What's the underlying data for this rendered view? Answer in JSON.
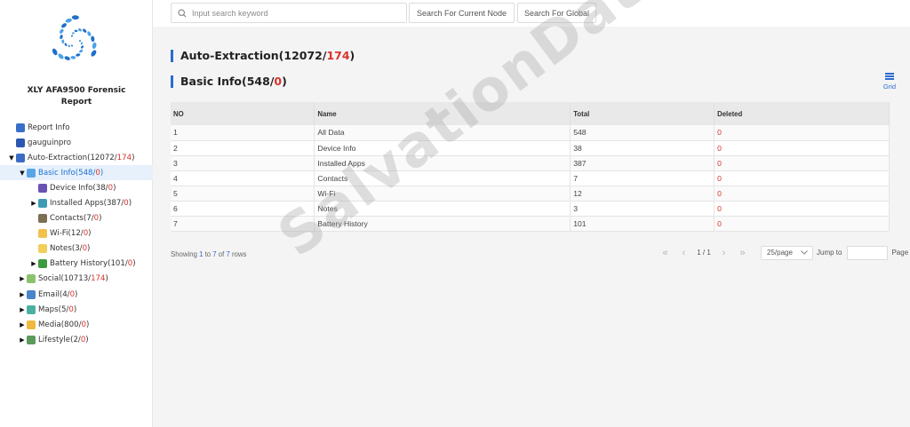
{
  "sidebar": {
    "report_title_line1": "XLY AFA9500 Forensic",
    "report_title_line2": "Report",
    "tree": [
      {
        "label": "Report Info",
        "count": "",
        "red": "",
        "close": "",
        "level": 0,
        "caret": "",
        "icon": "report-icon",
        "color": "#3a6fc9"
      },
      {
        "label": "gauguinpro",
        "count": "",
        "red": "",
        "close": "",
        "level": 0,
        "caret": "",
        "icon": "device-icon",
        "color": "#2d58b0"
      },
      {
        "label": "Auto-Extraction(",
        "count": "12072/",
        "red": "174",
        "close": ")",
        "level": 0,
        "caret": "▼",
        "icon": "extraction-icon",
        "color": "#3b6bc4"
      },
      {
        "label": "Basic Info(",
        "count": "548/",
        "red": "0",
        "close": ")",
        "level": 1,
        "caret": "▼",
        "icon": "basic-info-icon",
        "color": "#5aa5e6",
        "selected": true
      },
      {
        "label": "Device Info(",
        "count": "38/",
        "red": "0",
        "close": ")",
        "level": 2,
        "caret": "",
        "icon": "device-info-icon",
        "color": "#6a52b3"
      },
      {
        "label": "Installed Apps(",
        "count": "387/",
        "red": "0",
        "close": ")",
        "level": 2,
        "caret": "▶",
        "icon": "apps-icon",
        "color": "#3f9bb5"
      },
      {
        "label": "Contacts(",
        "count": "7/",
        "red": "0",
        "close": ")",
        "level": 2,
        "caret": "",
        "icon": "contacts-icon",
        "color": "#7a6f52"
      },
      {
        "label": "Wi-Fi(",
        "count": "12/",
        "red": "0",
        "close": ")",
        "level": 2,
        "caret": "",
        "icon": "wifi-icon",
        "color": "#f0c24a"
      },
      {
        "label": "Notes(",
        "count": "3/",
        "red": "0",
        "close": ")",
        "level": 2,
        "caret": "",
        "icon": "notes-icon",
        "color": "#f2cf5c"
      },
      {
        "label": "Battery History(",
        "count": "101/",
        "red": "0",
        "close": ")",
        "level": 2,
        "caret": "▶",
        "icon": "battery-icon",
        "color": "#3e9a3e"
      },
      {
        "label": "Social(",
        "count": "10713/",
        "red": "174",
        "close": ")",
        "level": 1,
        "caret": "▶",
        "icon": "social-icon",
        "color": "#8cc26b"
      },
      {
        "label": "Email(",
        "count": "4/",
        "red": "0",
        "close": ")",
        "level": 1,
        "caret": "▶",
        "icon": "email-icon",
        "color": "#4a86c8"
      },
      {
        "label": "Maps(",
        "count": "5/",
        "red": "0",
        "close": ")",
        "level": 1,
        "caret": "▶",
        "icon": "maps-icon",
        "color": "#4bb0a0"
      },
      {
        "label": "Media(",
        "count": "800/",
        "red": "0",
        "close": ")",
        "level": 1,
        "caret": "▶",
        "icon": "media-icon",
        "color": "#f0b83c"
      },
      {
        "label": "Lifestyle(",
        "count": "2/",
        "red": "0",
        "close": ")",
        "level": 1,
        "caret": "▶",
        "icon": "lifestyle-icon",
        "color": "#5a9a5a"
      }
    ]
  },
  "search": {
    "placeholder": "Input search keyword",
    "current_node_label": "Search For Current Node",
    "global_label": "Search For Global"
  },
  "main": {
    "auto_title": "Auto-Extraction(12072/",
    "auto_red": "174",
    "auto_close": ")",
    "basic_title": "Basic Info(548/",
    "basic_red": "0",
    "basic_close": ")",
    "grid_label": "Grid"
  },
  "table": {
    "columns": [
      "NO",
      "Name",
      "Total",
      "Deleted"
    ],
    "rows": [
      [
        "1",
        "All Data",
        "548",
        "0"
      ],
      [
        "2",
        "Device Info",
        "38",
        "0"
      ],
      [
        "3",
        "Installed Apps",
        "387",
        "0"
      ],
      [
        "4",
        "Contacts",
        "7",
        "0"
      ],
      [
        "5",
        "Wi-Fi",
        "12",
        "0"
      ],
      [
        "6",
        "Notes",
        "3",
        "0"
      ],
      [
        "7",
        "Battery History",
        "101",
        "0"
      ]
    ]
  },
  "pagination": {
    "showing_prefix": "Showing ",
    "from": "1",
    "to_word": " to ",
    "to": "7",
    "of_word": " of ",
    "total": "7",
    "rows_word": " rows",
    "page_indicator": "1 / 1",
    "page_size": "25/page",
    "jump_label": "Jump to",
    "page_label": "Page"
  },
  "watermark": "SalvationData",
  "colors": {
    "accent": "#2b6cd0",
    "deleted": "#d9342b",
    "selected_bg": "#e6f1fc"
  }
}
